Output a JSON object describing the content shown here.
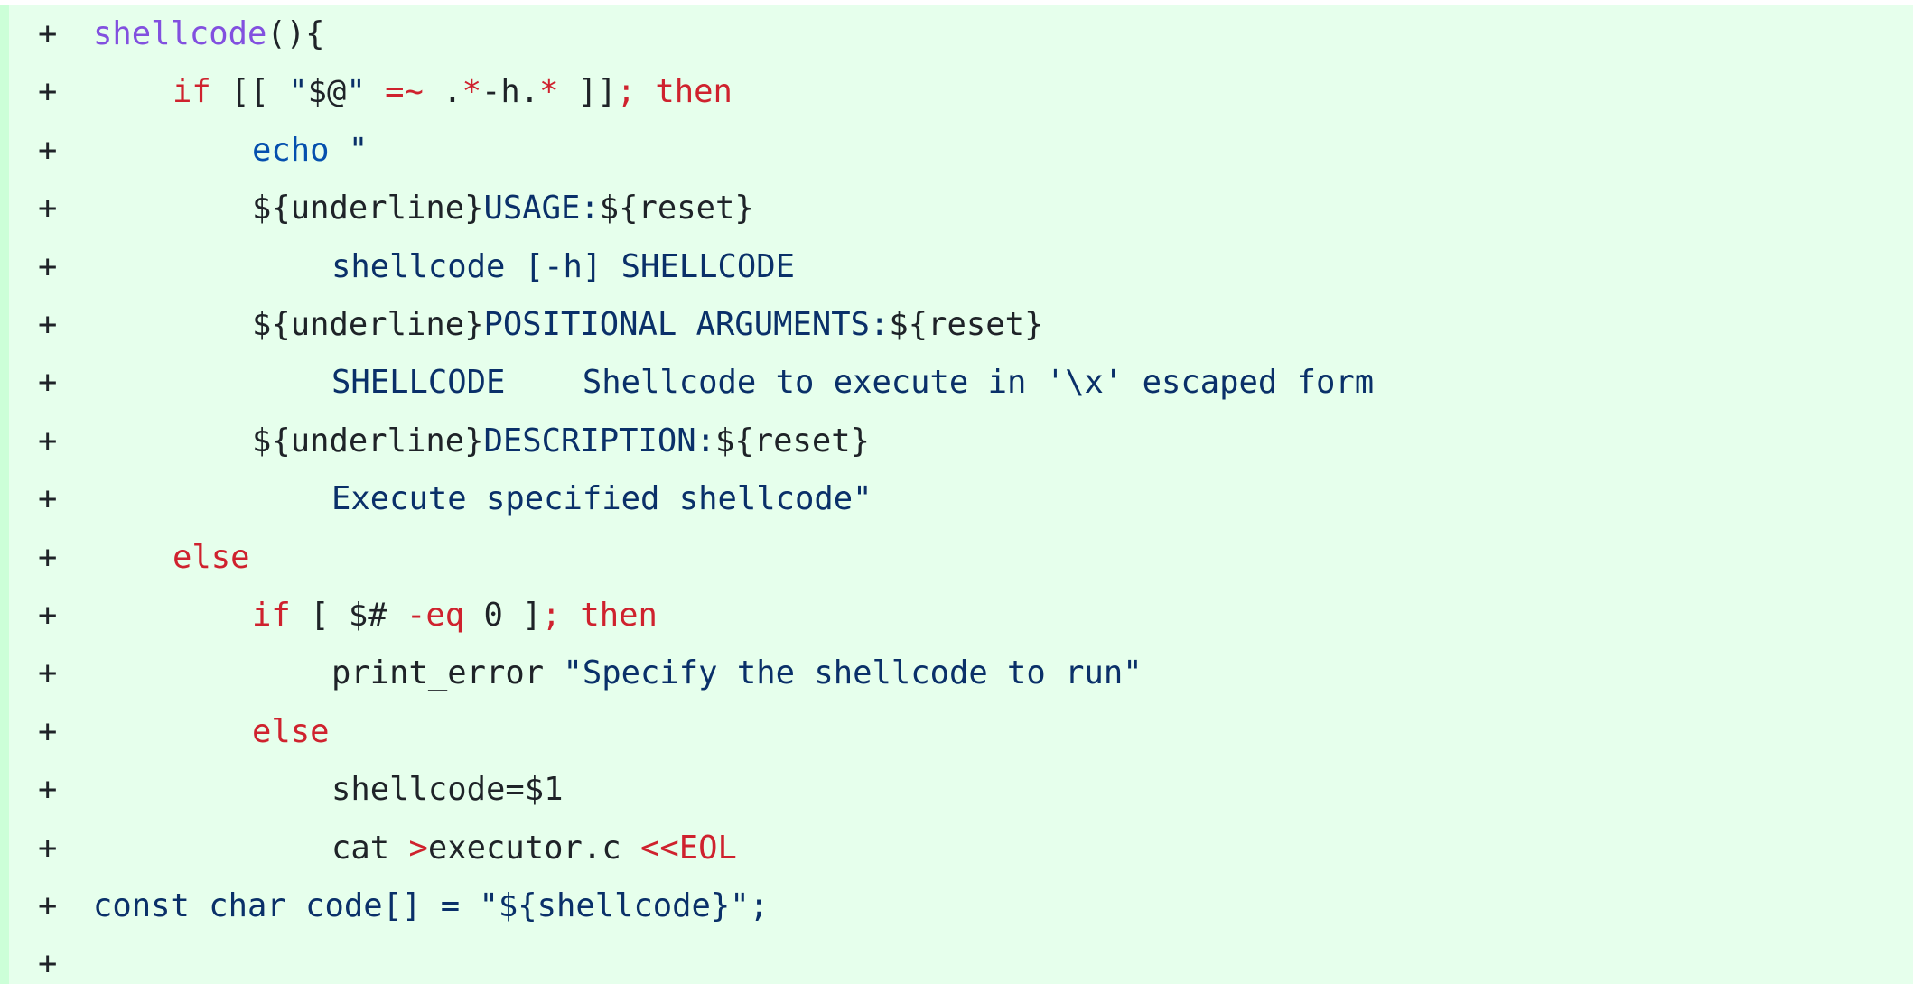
{
  "diff": {
    "marker": "+",
    "colors": {
      "added_background": "#e6ffec",
      "added_gutter": "#ccffd8",
      "keyword": "#cf222e",
      "string": "#0a3069",
      "function": "#8250df",
      "builtin": "#0550ae",
      "plain": "#1f2328"
    },
    "lines": [
      {
        "indent": 0,
        "tokens": [
          {
            "t": "shellcode",
            "c": "f"
          },
          {
            "t": "(){",
            "c": "p"
          }
        ]
      },
      {
        "indent": 1,
        "tokens": [
          {
            "t": "if",
            "c": "k"
          },
          {
            "t": " [[ ",
            "c": "p"
          },
          {
            "t": "\"",
            "c": "s"
          },
          {
            "t": "$@",
            "c": "p"
          },
          {
            "t": "\"",
            "c": "s"
          },
          {
            "t": " ",
            "c": "p"
          },
          {
            "t": "=~",
            "c": "k"
          },
          {
            "t": " .",
            "c": "p"
          },
          {
            "t": "*",
            "c": "k"
          },
          {
            "t": "-h.",
            "c": "p"
          },
          {
            "t": "*",
            "c": "k"
          },
          {
            "t": " ]]",
            "c": "p"
          },
          {
            "t": ";",
            "c": "k"
          },
          {
            "t": " ",
            "c": "p"
          },
          {
            "t": "then",
            "c": "k"
          }
        ]
      },
      {
        "indent": 2,
        "tokens": [
          {
            "t": "echo",
            "c": "b"
          },
          {
            "t": " \"",
            "c": "s"
          }
        ]
      },
      {
        "indent": 2,
        "tokens": [
          {
            "t": "${underline}",
            "c": "p"
          },
          {
            "t": "USAGE:",
            "c": "s"
          },
          {
            "t": "${reset}",
            "c": "p"
          }
        ]
      },
      {
        "indent": 3,
        "tokens": [
          {
            "t": "shellcode [-h] SHELLCODE",
            "c": "s"
          }
        ]
      },
      {
        "indent": 2,
        "tokens": [
          {
            "t": "${underline}",
            "c": "p"
          },
          {
            "t": "POSITIONAL ARGUMENTS:",
            "c": "s"
          },
          {
            "t": "${reset}",
            "c": "p"
          }
        ]
      },
      {
        "indent": 3,
        "tokens": [
          {
            "t": "SHELLCODE    Shellcode to execute in '\\x' escaped form",
            "c": "s"
          }
        ]
      },
      {
        "indent": 2,
        "tokens": [
          {
            "t": "${underline}",
            "c": "p"
          },
          {
            "t": "DESCRIPTION:",
            "c": "s"
          },
          {
            "t": "${reset}",
            "c": "p"
          }
        ]
      },
      {
        "indent": 3,
        "tokens": [
          {
            "t": "Execute specified shellcode\"",
            "c": "s"
          }
        ]
      },
      {
        "indent": 1,
        "tokens": [
          {
            "t": "else",
            "c": "k"
          }
        ]
      },
      {
        "indent": 2,
        "tokens": [
          {
            "t": "if",
            "c": "k"
          },
          {
            "t": " [ $# ",
            "c": "p"
          },
          {
            "t": "-eq",
            "c": "k"
          },
          {
            "t": " 0 ]",
            "c": "p"
          },
          {
            "t": ";",
            "c": "k"
          },
          {
            "t": " ",
            "c": "p"
          },
          {
            "t": "then",
            "c": "k"
          }
        ]
      },
      {
        "indent": 3,
        "tokens": [
          {
            "t": "print_error ",
            "c": "p"
          },
          {
            "t": "\"Specify the shellcode to run\"",
            "c": "s"
          }
        ]
      },
      {
        "indent": 2,
        "tokens": [
          {
            "t": "else",
            "c": "k"
          }
        ]
      },
      {
        "indent": 3,
        "tokens": [
          {
            "t": "shellcode=$1",
            "c": "p"
          }
        ]
      },
      {
        "indent": 3,
        "tokens": [
          {
            "t": "cat ",
            "c": "p"
          },
          {
            "t": ">",
            "c": "k"
          },
          {
            "t": "executor.c ",
            "c": "p"
          },
          {
            "t": "<<EOL",
            "c": "k"
          }
        ]
      },
      {
        "indent": 0,
        "tokens": [
          {
            "t": "const char code[] = \"${shellcode}\";",
            "c": "s"
          }
        ]
      },
      {
        "indent": 0,
        "tokens": []
      }
    ]
  }
}
